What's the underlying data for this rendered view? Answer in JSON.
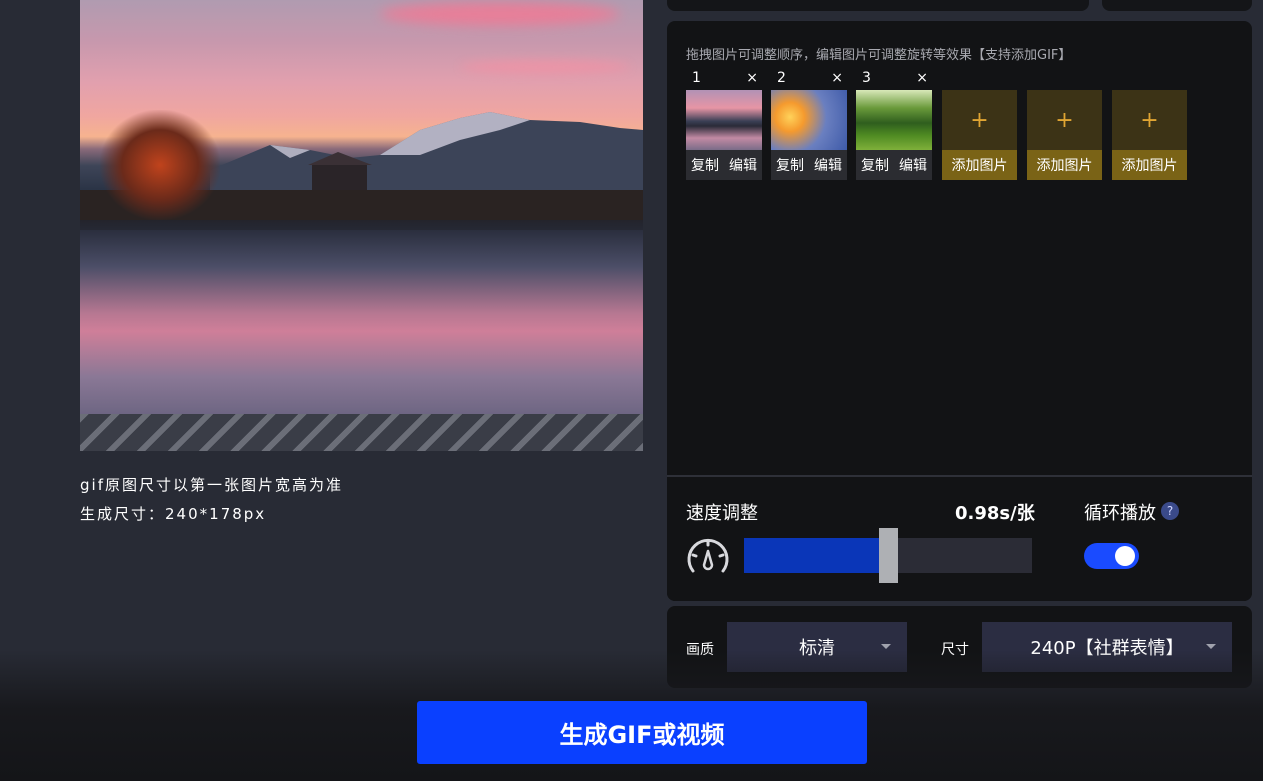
{
  "preview": {
    "note": "gif原图尺寸以第一张图片宽高为准",
    "size_label": "生成尺寸：",
    "size_value": "240*178px"
  },
  "images": {
    "hint": "拖拽图片可调整顺序，编辑图片可调整旋转等效果【支持添加GIF】",
    "items": [
      {
        "index": "1",
        "close": "×",
        "copy": "复制",
        "edit": "编辑"
      },
      {
        "index": "2",
        "close": "×",
        "copy": "复制",
        "edit": "编辑"
      },
      {
        "index": "3",
        "close": "×",
        "copy": "复制",
        "edit": "编辑"
      }
    ],
    "add_slots": [
      {
        "plus": "+",
        "label": "添加图片"
      },
      {
        "plus": "+",
        "label": "添加图片"
      },
      {
        "plus": "+",
        "label": "添加图片"
      }
    ]
  },
  "speed": {
    "title": "速度调整",
    "value": "0.98s/张",
    "slider_fraction": 0.47
  },
  "loop": {
    "title": "循环播放",
    "help": "?",
    "enabled": true
  },
  "quality": {
    "label": "画质",
    "value": "标清"
  },
  "size": {
    "label": "尺寸",
    "value": "240P【社群表情】"
  },
  "action": {
    "generate_label": "生成GIF或视频"
  },
  "colors": {
    "accent": "#0a40ff",
    "slider_fill": "#0a36b8",
    "add_slot": "#7a6316"
  }
}
